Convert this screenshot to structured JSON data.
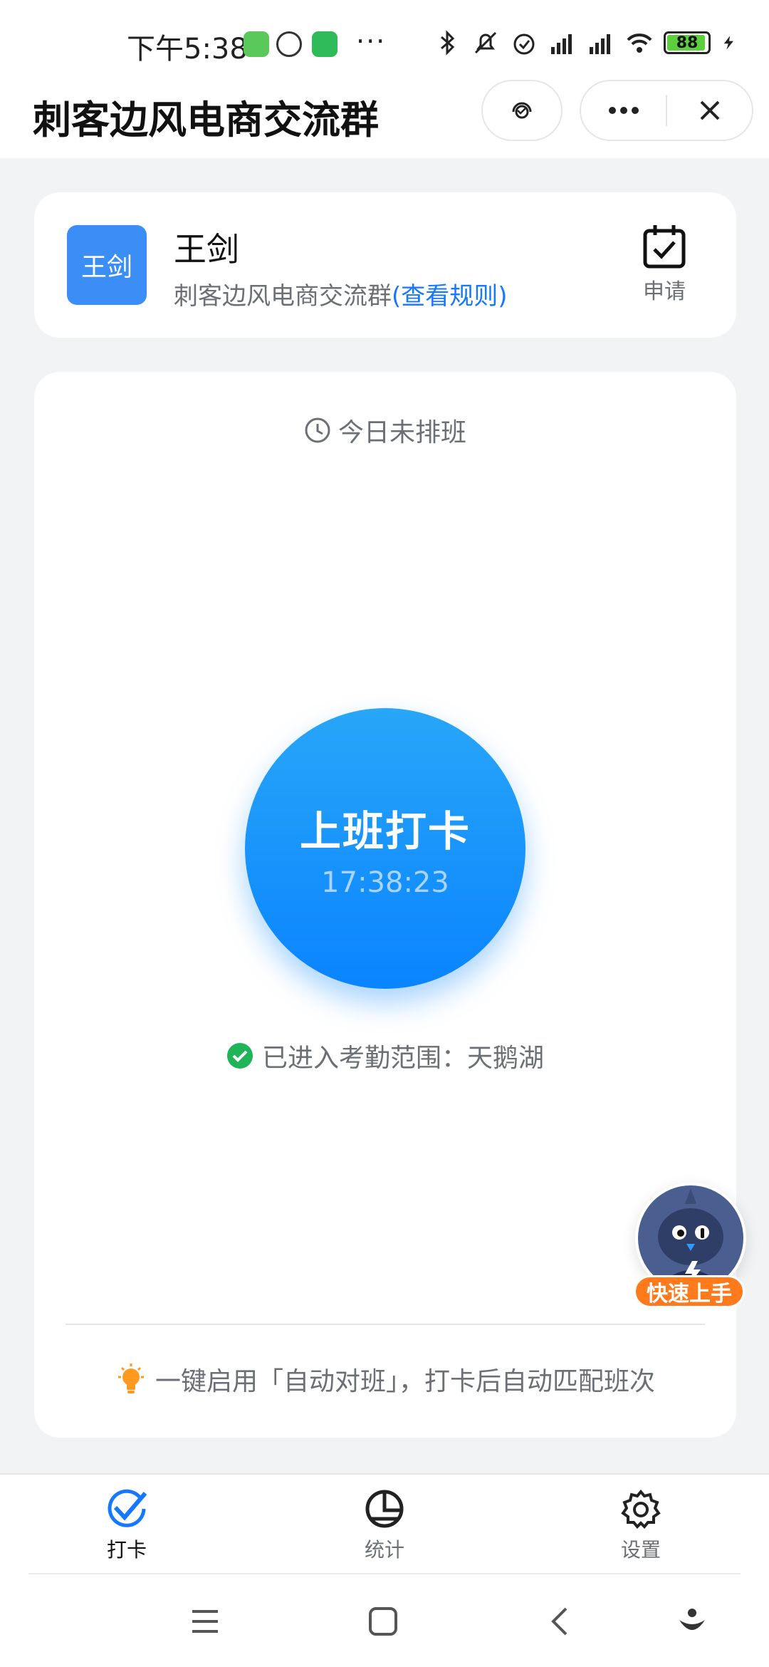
{
  "status_bar": {
    "time": "下午5:38",
    "dots": "···",
    "battery_level": "88"
  },
  "header": {
    "title": "刺客边风电商交流群"
  },
  "user_card": {
    "avatar_text": "王剑",
    "name": "王剑",
    "group_name": "刺客边风电商交流群",
    "rules_link": "(查看规则)",
    "apply_label": "申请"
  },
  "main": {
    "schedule_status": "今日未排班",
    "punch_label": "上班打卡",
    "punch_time": "17:38:23",
    "range_status": "已进入考勤范围：天鹅湖",
    "tip": "一键启用「自动对班」，打卡后自动匹配班次",
    "mascot_label": "快速上手"
  },
  "tabs": [
    {
      "label": "打卡",
      "icon": "check-icon",
      "active": true
    },
    {
      "label": "统计",
      "icon": "pie-chart-icon",
      "active": false
    },
    {
      "label": "设置",
      "icon": "gear-icon",
      "active": false
    }
  ],
  "colors": {
    "accent": "#1677ff",
    "punch_button": "#0a84ff",
    "success": "#1fb457",
    "badge": "#ff7a1a",
    "avatar": "#3a8ef6"
  }
}
